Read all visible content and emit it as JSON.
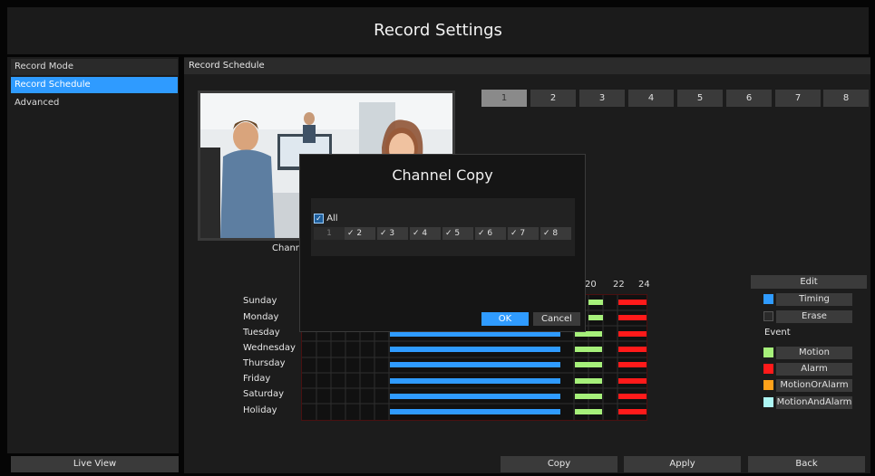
{
  "title": "Record Settings",
  "sidebar": {
    "items": [
      {
        "label": "Record Mode"
      },
      {
        "label": "Record Schedule"
      },
      {
        "label": "Advanced"
      }
    ],
    "live_view": "Live View"
  },
  "main": {
    "header": "Record Schedule",
    "preview_label": "Chann",
    "channels": [
      "1",
      "2",
      "3",
      "4",
      "5",
      "6",
      "7",
      "8"
    ],
    "active_channel": "1",
    "days": [
      "Sunday",
      "Monday",
      "Tuesday",
      "Wednesday",
      "Thursday",
      "Friday",
      "Saturday",
      "Holiday"
    ],
    "hour_labels": [
      "20",
      "22",
      "24"
    ]
  },
  "legend": {
    "edit": "Edit",
    "timing": "Timing",
    "erase": "Erase",
    "event": "Event",
    "motion": "Motion",
    "alarm": "Alarm",
    "motion_or_alarm": "MotionOrAlarm",
    "motion_and_alarm": "MotionAndAlarm"
  },
  "colors": {
    "timing": "#2f9bff",
    "erase": "#2a2a2a",
    "motion": "#a6f07a",
    "alarm": "#ff1a1a",
    "motion_or_alarm": "#ffa21a",
    "motion_and_alarm": "#aef7f4"
  },
  "bottom": {
    "copy": "Copy",
    "apply": "Apply",
    "back": "Back"
  },
  "dialog": {
    "title": "Channel Copy",
    "all_label": "All",
    "channels": [
      {
        "label": "1",
        "checked": false,
        "disabled": true
      },
      {
        "label": "2",
        "checked": true
      },
      {
        "label": "3",
        "checked": true
      },
      {
        "label": "4",
        "checked": true
      },
      {
        "label": "5",
        "checked": true
      },
      {
        "label": "6",
        "checked": true
      },
      {
        "label": "7",
        "checked": true
      },
      {
        "label": "8",
        "checked": true
      }
    ],
    "ok": "OK",
    "cancel": "Cancel"
  }
}
